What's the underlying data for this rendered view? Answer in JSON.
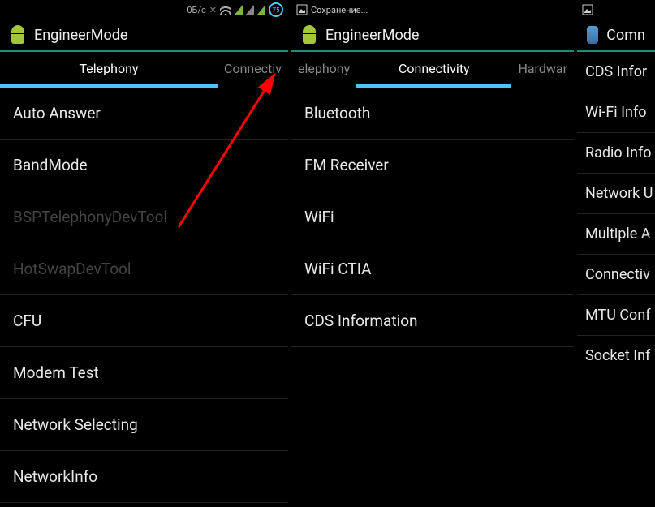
{
  "panel1": {
    "status": {
      "speed": "0Б/с",
      "battery": "75"
    },
    "title": "EngineerMode",
    "tabs": [
      {
        "label": "Telephony",
        "active": true
      },
      {
        "label": "Connectiv",
        "active": false
      }
    ],
    "items": [
      {
        "label": "Auto Answer",
        "disabled": false
      },
      {
        "label": "BandMode",
        "disabled": false
      },
      {
        "label": "BSPTelephonyDevTool",
        "disabled": true
      },
      {
        "label": "HotSwapDevTool",
        "disabled": true
      },
      {
        "label": "CFU",
        "disabled": false
      },
      {
        "label": "Modem Test",
        "disabled": false
      },
      {
        "label": "Network Selecting",
        "disabled": false
      },
      {
        "label": "NetworkInfo",
        "disabled": false
      }
    ]
  },
  "panel2": {
    "status": {
      "text": "Сохранение..."
    },
    "title": "EngineerMode",
    "tabs": [
      {
        "label": "elephony",
        "active": false
      },
      {
        "label": "Connectivity",
        "active": true
      },
      {
        "label": "Hardwar",
        "active": false
      }
    ],
    "items": [
      {
        "label": "Bluetooth"
      },
      {
        "label": "FM Receiver"
      },
      {
        "label": "WiFi"
      },
      {
        "label": "WiFi CTIA"
      },
      {
        "label": "CDS Information"
      }
    ]
  },
  "panel3": {
    "title": "Comn",
    "items": [
      {
        "label": "CDS Infor"
      },
      {
        "label": "Wi-Fi Info"
      },
      {
        "label": "Radio Info"
      },
      {
        "label": "Network U"
      },
      {
        "label": "Multiple A"
      },
      {
        "label": "Connectiv"
      },
      {
        "label": "MTU Conf"
      },
      {
        "label": "Socket Inf"
      }
    ]
  }
}
